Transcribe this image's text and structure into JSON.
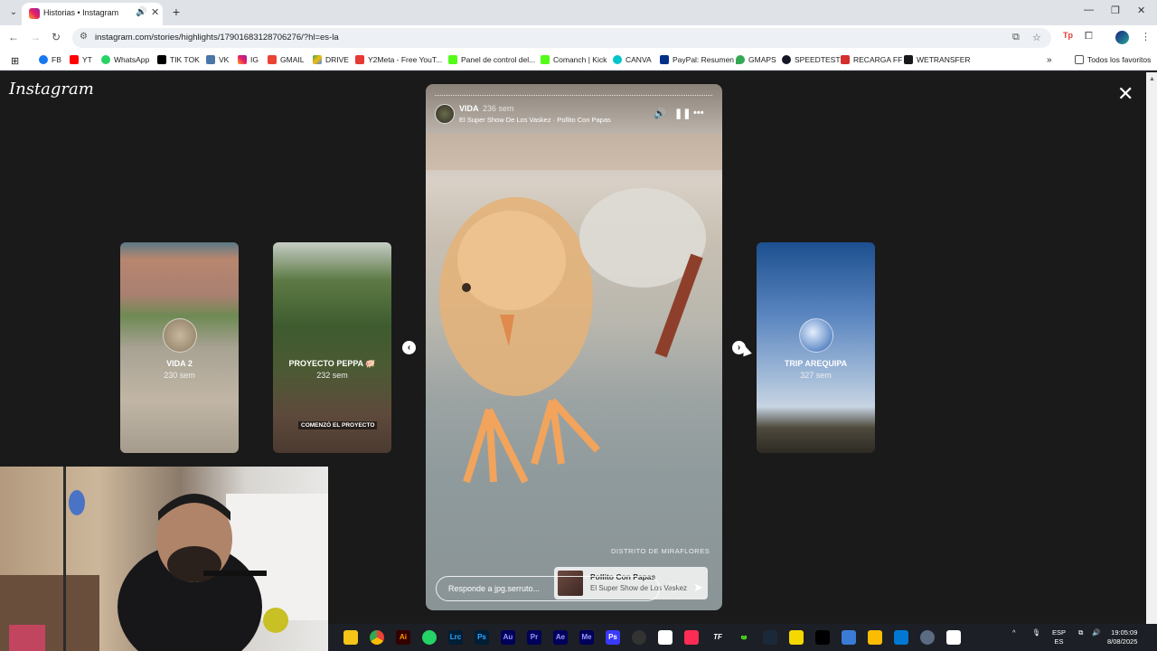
{
  "browser": {
    "tab_title": "Historias • Instagram",
    "url": "instagram.com/stories/highlights/17901683128706276/?hl=es-la",
    "bookmarks": [
      "FB",
      "YT",
      "WhatsApp",
      "TIK TOK",
      "VK",
      "IG",
      "GMAIL",
      "DRIVE",
      "Y2Meta - Free YouT...",
      "Panel de control del...",
      "Comanch | Kick",
      "CANVA",
      "PayPal: Resumen",
      "GMAPS",
      "SPEEDTEST",
      "RECARGA FF",
      "WETRANSFER"
    ],
    "all_bookmarks": "Todos los favoritos"
  },
  "instagram": {
    "logo": "Instagram",
    "story": {
      "username": "VIDA",
      "time": "236 sem",
      "music": "El Super Show De Los Vaskez · Pollito Con Papas",
      "reply_placeholder": "Responde a jpg.serruto...",
      "location": "DISTRITO DE MIRAFLORES",
      "music_sticker_title": "Pollito Con Papas",
      "music_sticker_artist": "El Super Show de Los Vaskez"
    },
    "highlights": [
      {
        "name": "VIDA 2",
        "age": "230 sem"
      },
      {
        "name": "PROYECTO PEPPA 🐖",
        "age": "232 sem",
        "caption": "COMENZÓ EL PROYECTO"
      },
      {
        "name": "TRIP AREQUIPA",
        "age": "327 sem"
      }
    ]
  },
  "taskbar": {
    "lang": "ESP",
    "lang_sub": "ES",
    "time": "19:05:09",
    "date": "8/08/2025"
  }
}
